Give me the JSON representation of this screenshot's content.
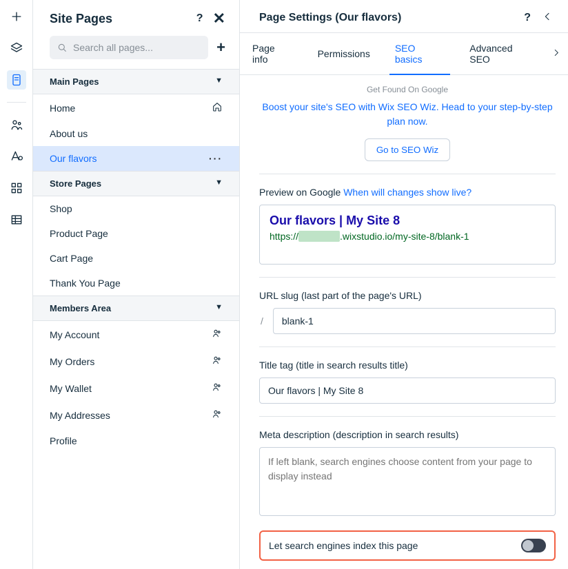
{
  "rail": {
    "items": [
      {
        "name": "add-icon"
      },
      {
        "name": "layers-icon"
      },
      {
        "name": "pages-icon"
      },
      {
        "name": "people-icon"
      },
      {
        "name": "styles-icon"
      },
      {
        "name": "apps-icon"
      },
      {
        "name": "data-icon"
      }
    ]
  },
  "pagesPanel": {
    "title": "Site Pages",
    "search_placeholder": "Search all pages...",
    "sections": [
      {
        "label": "Main Pages",
        "items": [
          {
            "label": "Home",
            "trail": "home-icon"
          },
          {
            "label": "About us"
          },
          {
            "label": "Our flavors",
            "selected": true,
            "trail": "dots"
          }
        ]
      },
      {
        "label": "Store Pages",
        "items": [
          {
            "label": "Shop"
          },
          {
            "label": "Product Page"
          },
          {
            "label": "Cart Page"
          },
          {
            "label": "Thank You Page"
          }
        ]
      },
      {
        "label": "Members Area",
        "items": [
          {
            "label": "My Account",
            "trail": "people-icon"
          },
          {
            "label": "My Orders",
            "trail": "people-icon"
          },
          {
            "label": "My Wallet",
            "trail": "people-icon"
          },
          {
            "label": "My Addresses",
            "trail": "people-icon"
          },
          {
            "label": "Profile"
          }
        ]
      }
    ]
  },
  "settings": {
    "title": "Page Settings (Our flavors)",
    "tabs": [
      "Page info",
      "Permissions",
      "SEO basics",
      "Advanced SEO"
    ],
    "active_tab": 2,
    "seo_intro": {
      "small": "Get Found On Google",
      "text": "Boost your site's SEO with Wix SEO Wiz. Head to your step-by-step plan now.",
      "button": "Go to SEO Wiz"
    },
    "preview": {
      "label_prefix": "Preview on Google",
      "link": "When will changes show live?",
      "title": "Our flavors | My Site 8",
      "url_prefix": "https://",
      "url_hidden": "xxxxxxxx",
      "url_suffix": ".wixstudio.io/my-site-8/blank-1"
    },
    "url_slug": {
      "label": "URL slug (last part of the page's URL)",
      "value": "blank-1"
    },
    "title_tag": {
      "label": "Title tag (title in search results title)",
      "value": "Our flavors | My Site 8"
    },
    "meta": {
      "label": "Meta description (description in search results)",
      "placeholder": "If left blank, search engines choose content from your page to display instead"
    },
    "index": {
      "label": "Let search engines index this page",
      "on": false
    }
  }
}
